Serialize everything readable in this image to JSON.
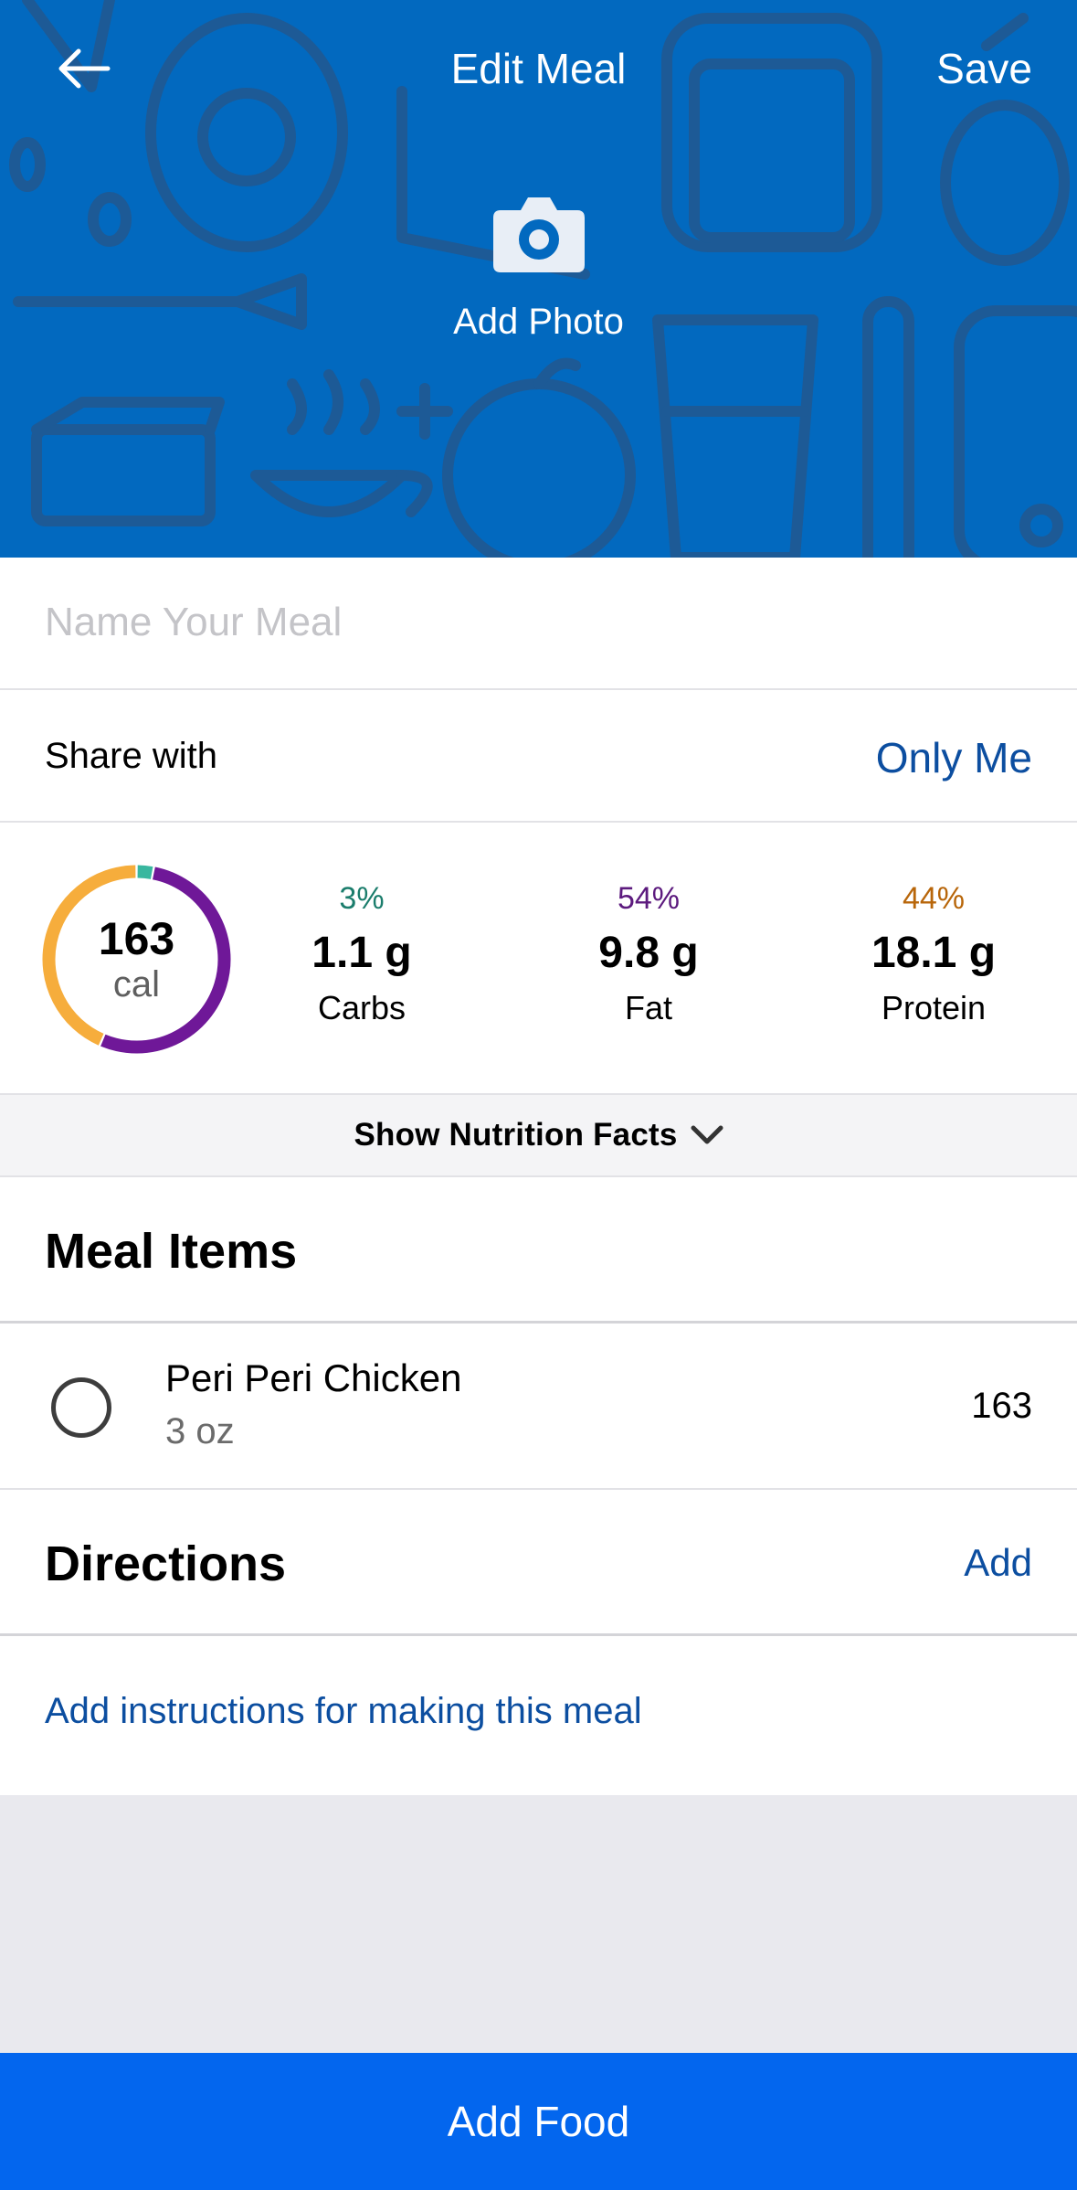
{
  "header": {
    "title": "Edit Meal",
    "save_label": "Save",
    "back_icon": "arrow-left-icon",
    "add_photo_label": "Add Photo",
    "camera_icon": "camera-icon",
    "background_color": "#0269bf"
  },
  "name_field": {
    "placeholder": "Name Your Meal",
    "value": ""
  },
  "share": {
    "label": "Share with",
    "value": "Only Me"
  },
  "summary": {
    "calories": "163",
    "calories_unit": "cal",
    "ring_segments": [
      {
        "name": "Carbs",
        "fraction": 0.03,
        "color": "#39b79f"
      },
      {
        "name": "Fat",
        "fraction": 0.54,
        "color": "#6f1898"
      },
      {
        "name": "Protein",
        "fraction": 0.44,
        "color": "#f6ad3c"
      }
    ],
    "macros": [
      {
        "percent": "3%",
        "amount": "1.1 g",
        "label": "Carbs",
        "color": "#1b7d6c"
      },
      {
        "percent": "54%",
        "amount": "9.8 g",
        "label": "Fat",
        "color": "#5c1a7e"
      },
      {
        "percent": "44%",
        "amount": "18.1 g",
        "label": "Protein",
        "color": "#b8660a"
      }
    ]
  },
  "nutrition_toggle": {
    "label": "Show Nutrition Facts",
    "icon": "chevron-down-icon"
  },
  "meal_items": {
    "title": "Meal Items",
    "items": [
      {
        "name": "Peri Peri Chicken",
        "quantity": "3 oz",
        "calories": "163"
      }
    ]
  },
  "directions": {
    "title": "Directions",
    "add_label": "Add",
    "hint": "Add instructions for making this meal"
  },
  "footer": {
    "add_food_label": "Add Food",
    "color": "#0366ee"
  }
}
